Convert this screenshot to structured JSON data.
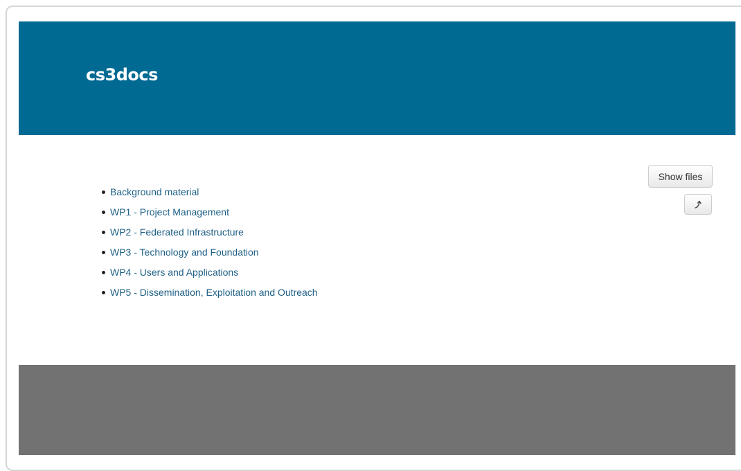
{
  "site": {
    "title": "cs3docs"
  },
  "documents": [
    {
      "label": "Background material"
    },
    {
      "label": "WP1 - Project Management"
    },
    {
      "label": "WP2 - Federated Infrastructure"
    },
    {
      "label": "WP3 - Technology and Foundation"
    },
    {
      "label": "WP4 - Users and Applications"
    },
    {
      "label": "WP5 - Dissemination, Exploitation and Outreach"
    }
  ],
  "toolbar": {
    "show_files_label": "Show files",
    "open_icon": "external-arrow-icon"
  },
  "colors": {
    "header_bg": "#006a93",
    "footer_bg": "#727272",
    "link": "#1d5f85"
  }
}
